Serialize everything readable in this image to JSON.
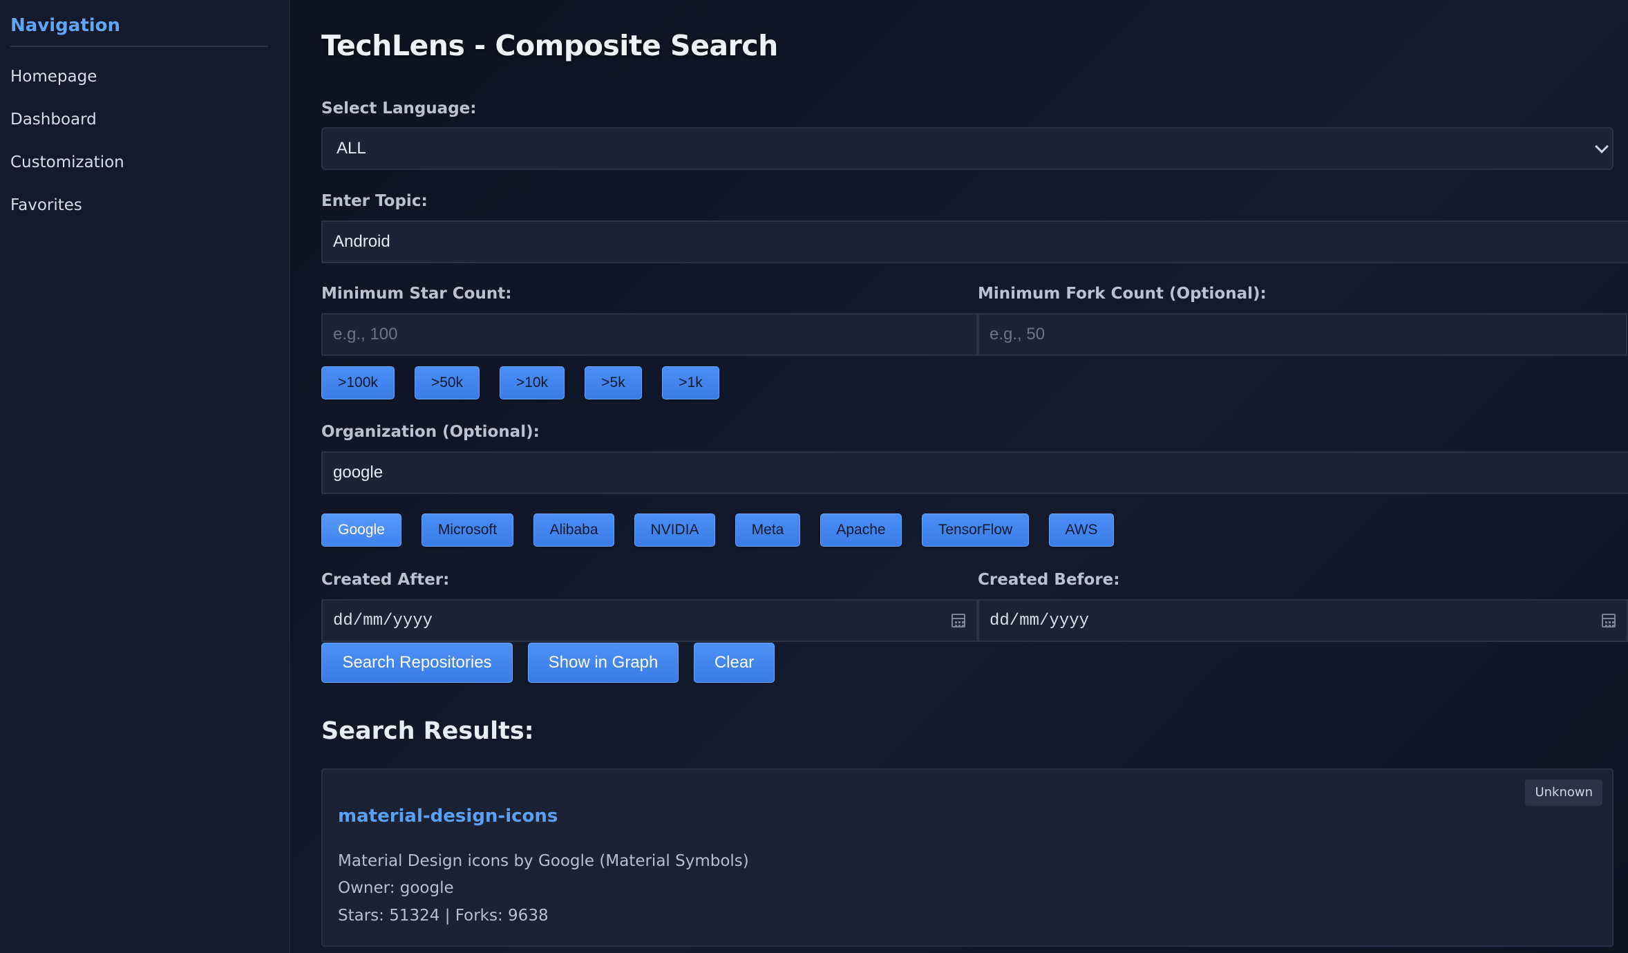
{
  "sidebar": {
    "title": "Navigation",
    "items": [
      {
        "label": "Homepage"
      },
      {
        "label": "Dashboard"
      },
      {
        "label": "Customization"
      },
      {
        "label": "Favorites"
      }
    ]
  },
  "page": {
    "title": "TechLens - Composite Search"
  },
  "language": {
    "label": "Select Language:",
    "selected": "ALL"
  },
  "topic": {
    "label": "Enter Topic:",
    "value": "Android"
  },
  "stars": {
    "label": "Minimum Star Count:",
    "placeholder": "e.g., 100",
    "presets": [
      ">100k",
      ">50k",
      ">10k",
      ">5k",
      ">1k"
    ]
  },
  "forks": {
    "label": "Minimum Fork Count (Optional):",
    "placeholder": "e.g., 50"
  },
  "organization": {
    "label": "Organization (Optional):",
    "value": "google",
    "presets": [
      "Google",
      "Microsoft",
      "Alibaba",
      "NVIDIA",
      "Meta",
      "Apache",
      "TensorFlow",
      "AWS"
    ]
  },
  "created_after": {
    "label": "Created After:",
    "value": "dd/mm/yyyy"
  },
  "created_before": {
    "label": "Created Before:",
    "value": "dd/mm/yyyy"
  },
  "actions": {
    "search": "Search Repositories",
    "graph": "Show in Graph",
    "clear": "Clear"
  },
  "results": {
    "heading": "Search Results:",
    "items": [
      {
        "name": "material-design-icons",
        "badge": "Unknown",
        "description": "Material Design icons by Google (Material Symbols)",
        "owner": "Owner: google",
        "stats": "Stars: 51324 | Forks: 9638"
      }
    ]
  },
  "colors": {
    "accent": "#60a5fa",
    "button": "#3b82f6",
    "background": "#0f1422"
  }
}
